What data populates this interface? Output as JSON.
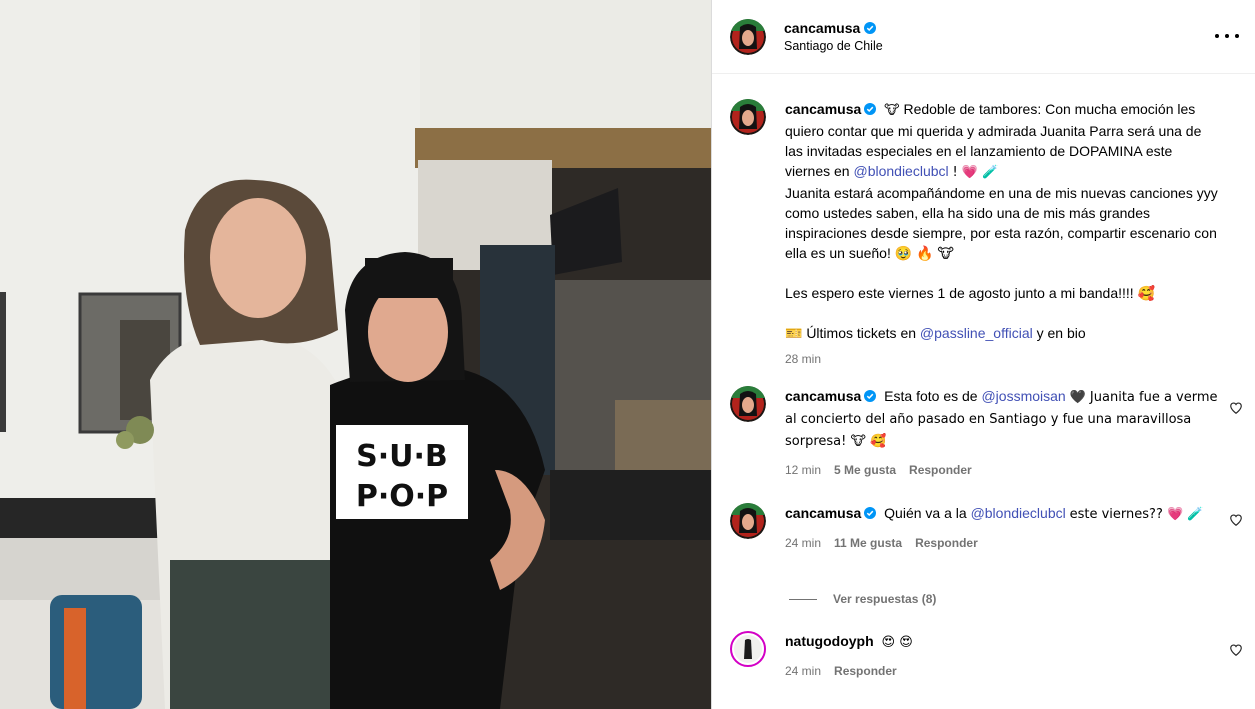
{
  "post": {
    "username": "cancamusa",
    "location": "Santiago de Chile",
    "more_icon": "more-horizontal-icon"
  },
  "caption": {
    "username": "cancamusa",
    "line1_emoji": "🐮",
    "line1_pre": "Redoble de tambores: Con mucha emoción les quiero contar que mi querida y admirada Juanita Parra será una de las invitadas especiales en el lanzamiento de DOPAMINA este viernes en",
    "mention1": "@blondieclubcl",
    "line1_post": "! 💗 🧪",
    "para2": "Juanita estará acompañándome en una de mis nuevas canciones yyy como ustedes saben, ella ha sido una de mis más grandes inspiraciones desde siempre, por esta razón, compartir escenario con ella es un sueño! 🥹 🔥 🐮",
    "para3": "Les espero este viernes 1 de agosto junto a mi banda!!!! 🥰",
    "para4_pre": "🎫 Últimos tickets en",
    "mention2": "@passline_official",
    "para4_post": "y en bio",
    "time": "28 min"
  },
  "comments": [
    {
      "username": "cancamusa",
      "text_pre": "Esta foto es de",
      "mention": "@jossmoisan",
      "text_post": "🖤 Juanita fue a verme al concierto del año pasado en Santiago y fue una maravillosa sorpresa! 🐮 🥰",
      "time": "12 min",
      "likes": "5 Me gusta",
      "reply": "Responder"
    },
    {
      "username": "cancamusa",
      "text_pre": "Quién va a la",
      "mention": "@blondieclubcl",
      "text_post": "este viernes?? 💗 🧪",
      "time": "24 min",
      "likes": "11 Me gusta",
      "reply": "Responder"
    },
    {
      "username": "natugodoyph",
      "text_pre": "😍 😍",
      "mention": "",
      "text_post": "",
      "time": "24 min",
      "likes": "",
      "reply": "Responder"
    }
  ],
  "view_replies": "Ver respuestas (8)",
  "colors": {
    "mention": "#4150b5",
    "muted": "#737373",
    "verified": "#0095f6",
    "border": "#dbdbdb"
  }
}
